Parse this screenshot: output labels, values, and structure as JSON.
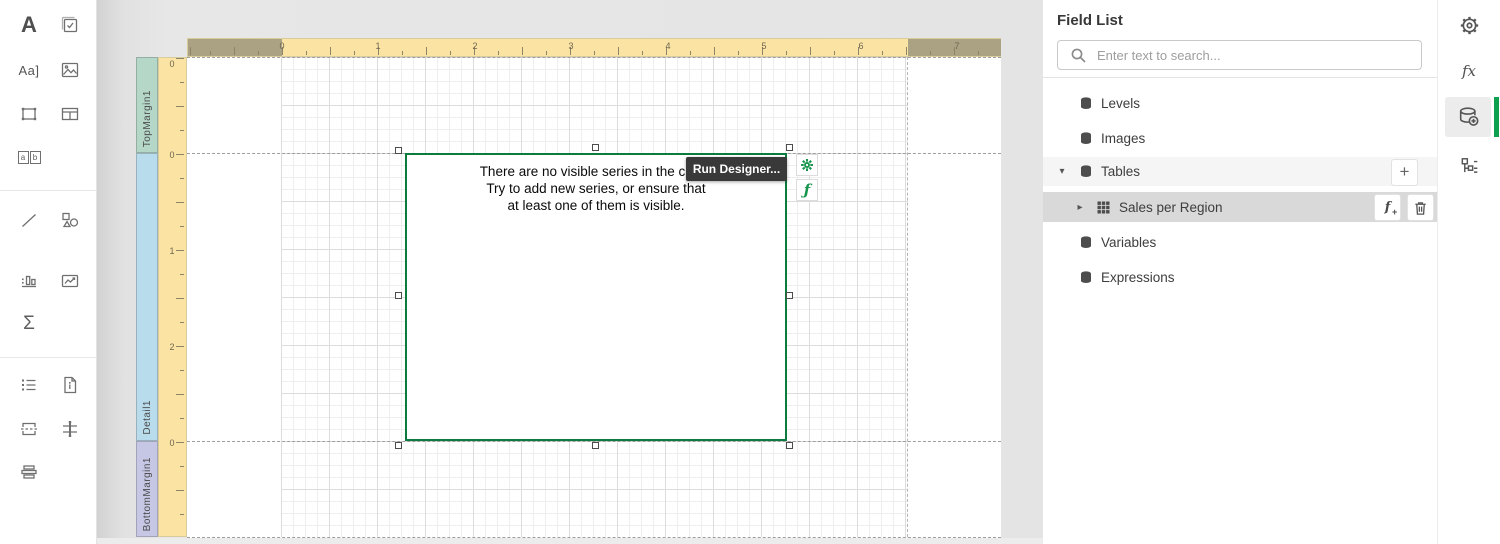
{
  "toolbox": {
    "glyphs": {
      "label": "A",
      "richtext": "Aa]",
      "charcomb_a": "a",
      "charcomb_b": "b",
      "summary": "Σ"
    }
  },
  "canvas": {
    "h_ruler": [
      "0",
      "1",
      "2",
      "3",
      "4",
      "5",
      "6",
      "7"
    ],
    "v_ruler": [
      "0",
      "0",
      "1",
      "2",
      "0"
    ],
    "bands": [
      {
        "label": "TopMargin1",
        "color": "#b4d7c8"
      },
      {
        "label": "Detail1",
        "color": "#b9dcec"
      },
      {
        "label": "BottomMargin1",
        "color": "#c6c7e5"
      }
    ],
    "chart": {
      "message_line1": "There are no visible series in the chart.",
      "message_line2": "Try to add new series, or ensure that",
      "message_line3": "at least one of them is visible.",
      "run_designer_label": "Run Designer..."
    }
  },
  "field_list": {
    "title": "Field List",
    "search": {
      "placeholder": "Enter text to search...",
      "value": ""
    },
    "items": [
      {
        "label": "Levels"
      },
      {
        "label": "Images"
      },
      {
        "label": "Tables",
        "expanded": true
      },
      {
        "label": "Sales per Region",
        "selected": true
      },
      {
        "label": "Variables"
      },
      {
        "label": "Expressions"
      }
    ]
  },
  "right_bar": {
    "fx_glyph": "fx"
  },
  "colors": {
    "selection_green": "#0d7a3e",
    "smart_tag_green": "#17954d",
    "active_indicator_green": "#0da04e",
    "ruler_yellow": "#fbe3a4",
    "ruler_dark": "#aba283",
    "band_top_margin": "#b4d7c8",
    "band_detail": "#b9dcec",
    "band_bottom_margin": "#c6c7e5"
  }
}
